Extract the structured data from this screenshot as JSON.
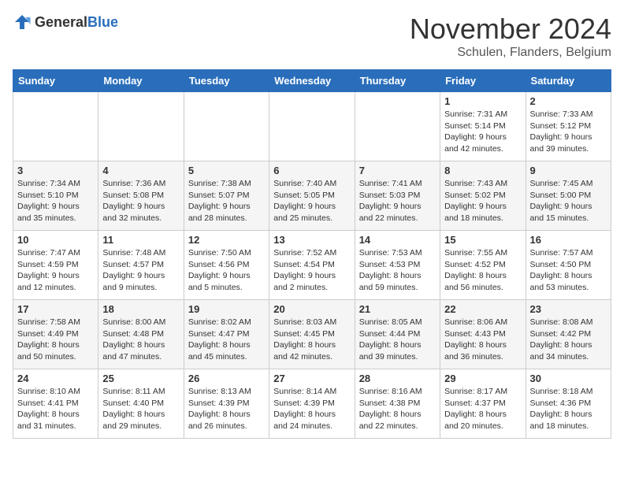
{
  "logo": {
    "text_general": "General",
    "text_blue": "Blue"
  },
  "title": "November 2024",
  "subtitle": "Schulen, Flanders, Belgium",
  "days_of_week": [
    "Sunday",
    "Monday",
    "Tuesday",
    "Wednesday",
    "Thursday",
    "Friday",
    "Saturday"
  ],
  "weeks": [
    [
      null,
      null,
      null,
      null,
      null,
      {
        "day": "1",
        "sunrise": "7:31 AM",
        "sunset": "5:14 PM",
        "daylight": "9 hours and 42 minutes."
      },
      {
        "day": "2",
        "sunrise": "7:33 AM",
        "sunset": "5:12 PM",
        "daylight": "9 hours and 39 minutes."
      }
    ],
    [
      {
        "day": "3",
        "sunrise": "7:34 AM",
        "sunset": "5:10 PM",
        "daylight": "9 hours and 35 minutes."
      },
      {
        "day": "4",
        "sunrise": "7:36 AM",
        "sunset": "5:08 PM",
        "daylight": "9 hours and 32 minutes."
      },
      {
        "day": "5",
        "sunrise": "7:38 AM",
        "sunset": "5:07 PM",
        "daylight": "9 hours and 28 minutes."
      },
      {
        "day": "6",
        "sunrise": "7:40 AM",
        "sunset": "5:05 PM",
        "daylight": "9 hours and 25 minutes."
      },
      {
        "day": "7",
        "sunrise": "7:41 AM",
        "sunset": "5:03 PM",
        "daylight": "9 hours and 22 minutes."
      },
      {
        "day": "8",
        "sunrise": "7:43 AM",
        "sunset": "5:02 PM",
        "daylight": "9 hours and 18 minutes."
      },
      {
        "day": "9",
        "sunrise": "7:45 AM",
        "sunset": "5:00 PM",
        "daylight": "9 hours and 15 minutes."
      }
    ],
    [
      {
        "day": "10",
        "sunrise": "7:47 AM",
        "sunset": "4:59 PM",
        "daylight": "9 hours and 12 minutes."
      },
      {
        "day": "11",
        "sunrise": "7:48 AM",
        "sunset": "4:57 PM",
        "daylight": "9 hours and 9 minutes."
      },
      {
        "day": "12",
        "sunrise": "7:50 AM",
        "sunset": "4:56 PM",
        "daylight": "9 hours and 5 minutes."
      },
      {
        "day": "13",
        "sunrise": "7:52 AM",
        "sunset": "4:54 PM",
        "daylight": "9 hours and 2 minutes."
      },
      {
        "day": "14",
        "sunrise": "7:53 AM",
        "sunset": "4:53 PM",
        "daylight": "8 hours and 59 minutes."
      },
      {
        "day": "15",
        "sunrise": "7:55 AM",
        "sunset": "4:52 PM",
        "daylight": "8 hours and 56 minutes."
      },
      {
        "day": "16",
        "sunrise": "7:57 AM",
        "sunset": "4:50 PM",
        "daylight": "8 hours and 53 minutes."
      }
    ],
    [
      {
        "day": "17",
        "sunrise": "7:58 AM",
        "sunset": "4:49 PM",
        "daylight": "8 hours and 50 minutes."
      },
      {
        "day": "18",
        "sunrise": "8:00 AM",
        "sunset": "4:48 PM",
        "daylight": "8 hours and 47 minutes."
      },
      {
        "day": "19",
        "sunrise": "8:02 AM",
        "sunset": "4:47 PM",
        "daylight": "8 hours and 45 minutes."
      },
      {
        "day": "20",
        "sunrise": "8:03 AM",
        "sunset": "4:45 PM",
        "daylight": "8 hours and 42 minutes."
      },
      {
        "day": "21",
        "sunrise": "8:05 AM",
        "sunset": "4:44 PM",
        "daylight": "8 hours and 39 minutes."
      },
      {
        "day": "22",
        "sunrise": "8:06 AM",
        "sunset": "4:43 PM",
        "daylight": "8 hours and 36 minutes."
      },
      {
        "day": "23",
        "sunrise": "8:08 AM",
        "sunset": "4:42 PM",
        "daylight": "8 hours and 34 minutes."
      }
    ],
    [
      {
        "day": "24",
        "sunrise": "8:10 AM",
        "sunset": "4:41 PM",
        "daylight": "8 hours and 31 minutes."
      },
      {
        "day": "25",
        "sunrise": "8:11 AM",
        "sunset": "4:40 PM",
        "daylight": "8 hours and 29 minutes."
      },
      {
        "day": "26",
        "sunrise": "8:13 AM",
        "sunset": "4:39 PM",
        "daylight": "8 hours and 26 minutes."
      },
      {
        "day": "27",
        "sunrise": "8:14 AM",
        "sunset": "4:39 PM",
        "daylight": "8 hours and 24 minutes."
      },
      {
        "day": "28",
        "sunrise": "8:16 AM",
        "sunset": "4:38 PM",
        "daylight": "8 hours and 22 minutes."
      },
      {
        "day": "29",
        "sunrise": "8:17 AM",
        "sunset": "4:37 PM",
        "daylight": "8 hours and 20 minutes."
      },
      {
        "day": "30",
        "sunrise": "8:18 AM",
        "sunset": "4:36 PM",
        "daylight": "8 hours and 18 minutes."
      }
    ]
  ]
}
